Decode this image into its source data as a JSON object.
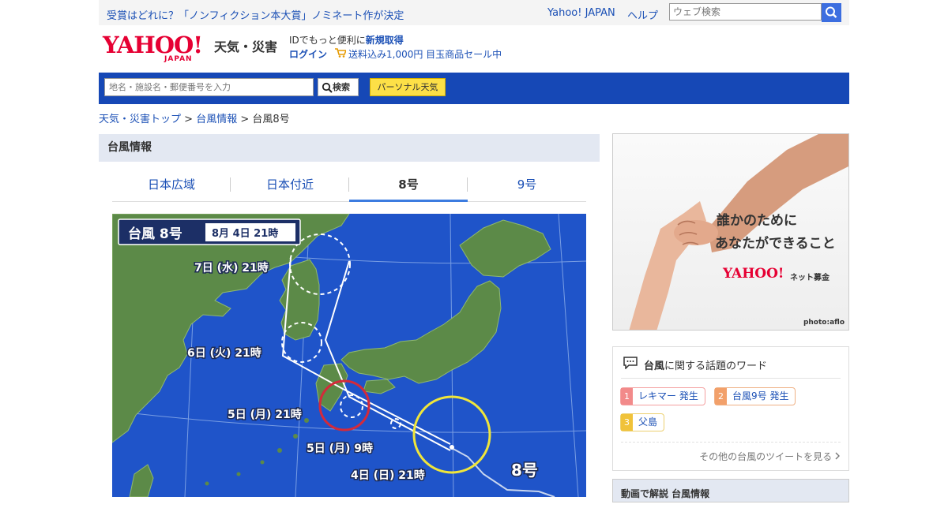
{
  "topbar": {
    "notice": "受賞はどれに？「ノンフィクション本大賞」ノミネート作が決定",
    "link_yahoo": "Yahoo! JAPAN",
    "link_help": "ヘルプ",
    "web_search_placeholder": "ウェブ検索"
  },
  "header": {
    "logo_text": "YAHOO!",
    "logo_sub": "JAPAN",
    "service_name": "天気・災害",
    "id_text": "IDでもっと便利に",
    "register_link": "新規取得",
    "login_link": "ログイン",
    "promo": "送料込み1,000円 目玉商品セール中"
  },
  "search": {
    "placeholder": "地名・施設名・郵便番号を入力",
    "button": "検索",
    "personal_button": "パーソナル天気"
  },
  "breadcrumb": {
    "item1": "天気・災害トップ",
    "item2": "台風情報",
    "current": "台風8号",
    "sep": ">"
  },
  "section": {
    "title": "台風情報",
    "tabs": [
      "日本広域",
      "日本付近",
      "8号",
      "9号"
    ],
    "active_tab": 2
  },
  "map": {
    "typhoon_title": "台風 8号",
    "timestamp": "8月 4日 21時",
    "labels": {
      "t1": "7日 (水) 21時",
      "t2": "6日 (火) 21時",
      "t3": "5日 (月) 21時",
      "t4": "5日 (月) 9時",
      "t5": "4日 (日) 21時",
      "name": "8号"
    },
    "colors": {
      "sea": "#1f54c9",
      "land": "#5c8a48",
      "storm_circle": "#f0e63a",
      "warning_circle": "#d42a3a"
    }
  },
  "ad": {
    "line1": "誰かのために",
    "line2": "あなたができること",
    "logo": "YAHOO!",
    "logo_service": "ネット募金",
    "credit": "photo:aflo"
  },
  "topics": {
    "title_bold": "台風",
    "title_rest": "に関する話題のワード",
    "items": [
      {
        "rank": "1",
        "label": "レキマー 発生",
        "color": "#f28a8a"
      },
      {
        "rank": "2",
        "label": "台風9号 発生",
        "color": "#f2a06a"
      },
      {
        "rank": "3",
        "label": "父島",
        "color": "#f0c23a"
      }
    ],
    "more": "その他の台風のツイートを見る"
  },
  "video": {
    "title": "動画で解説 台風情報"
  }
}
